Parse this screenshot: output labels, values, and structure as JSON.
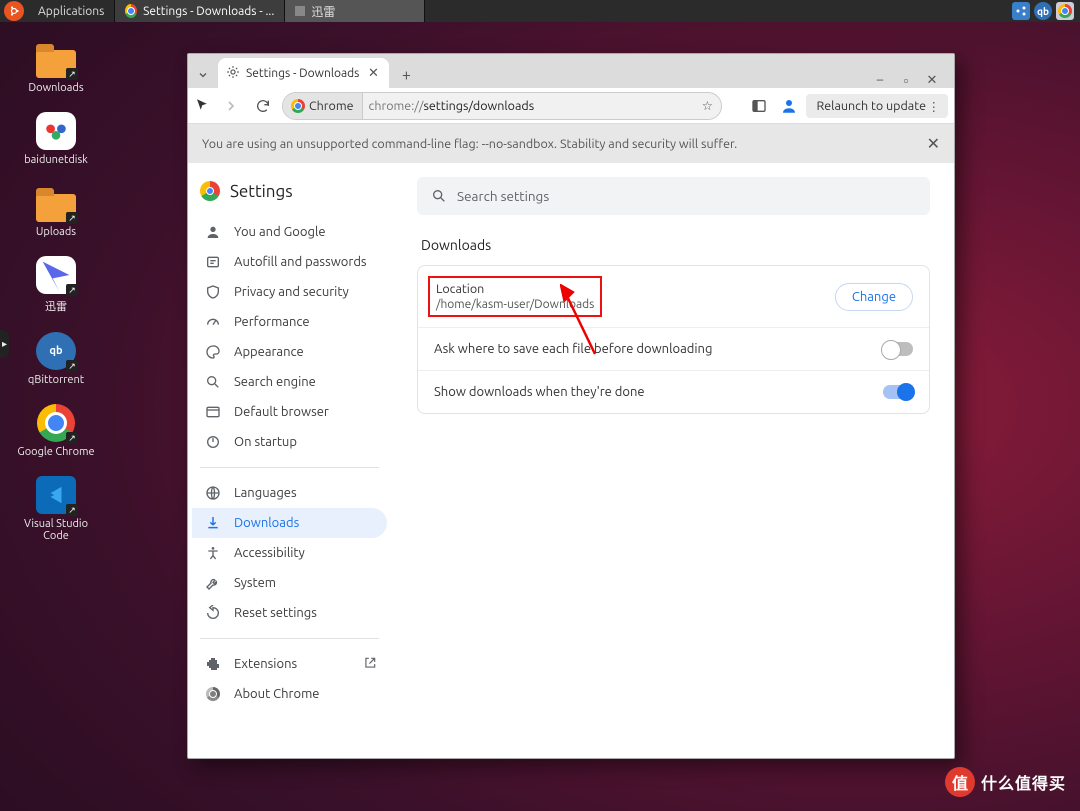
{
  "panel": {
    "applications": "Applications",
    "task1": "Settings - Downloads - ...",
    "task2": "迅雷"
  },
  "desktop_icons": {
    "downloads": "Downloads",
    "baidunetdisk": "baidunetdisk",
    "uploads": "Uploads",
    "xunlei": "迅雷",
    "qbittorrent": "qBittorrent",
    "chrome": "Google Chrome",
    "vscode": "Visual Studio Code"
  },
  "browser": {
    "tab_title": "Settings - Downloads",
    "omnibox": {
      "chip": "Chrome",
      "prefix": "chrome://",
      "path": "settings/downloads"
    },
    "relaunch": "Relaunch to update",
    "warning": "You are using an unsupported command-line flag: --no-sandbox. Stability and security will suffer."
  },
  "settings": {
    "title": "Settings",
    "search_placeholder": "Search settings",
    "nav": {
      "you_and_google": "You and Google",
      "autofill": "Autofill and passwords",
      "privacy": "Privacy and security",
      "performance": "Performance",
      "appearance": "Appearance",
      "search_engine": "Search engine",
      "default_browser": "Default browser",
      "on_startup": "On startup",
      "languages": "Languages",
      "downloads": "Downloads",
      "accessibility": "Accessibility",
      "system": "System",
      "reset": "Reset settings",
      "extensions": "Extensions",
      "about": "About Chrome"
    },
    "section_title": "Downloads",
    "location_label": "Location",
    "location_value": "/home/kasm-user/Downloads",
    "change": "Change",
    "ask_where": "Ask where to save each file before downloading",
    "show_when_done": "Show downloads when they're done"
  },
  "watermark": {
    "badge": "值",
    "text": "什么值得买"
  }
}
